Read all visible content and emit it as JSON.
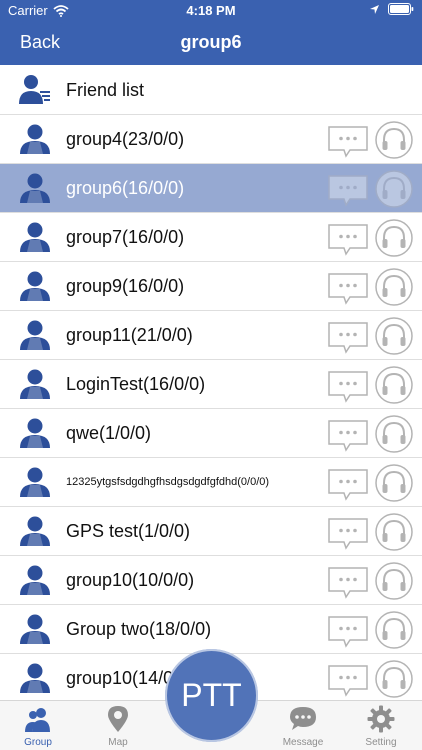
{
  "status": {
    "carrier": "Carrier",
    "time": "4:18 PM"
  },
  "nav": {
    "back_label": "Back",
    "title": "group6"
  },
  "friend_list": {
    "label": "Friend list"
  },
  "groups": [
    {
      "label": "group4(23/0/0)",
      "selected": false
    },
    {
      "label": "group6(16/0/0)",
      "selected": true
    },
    {
      "label": "group7(16/0/0)",
      "selected": false
    },
    {
      "label": "group9(16/0/0)",
      "selected": false
    },
    {
      "label": "group11(21/0/0)",
      "selected": false
    },
    {
      "label": "LoginTest(16/0/0)",
      "selected": false
    },
    {
      "label": "qwe(1/0/0)",
      "selected": false
    },
    {
      "label": "12325ytgsfsdgdhgfhsdgsdgdfgfdhd(0/0/0)",
      "selected": false,
      "small": true
    },
    {
      "label": "GPS test(1/0/0)",
      "selected": false
    },
    {
      "label": "group10(10/0/0)",
      "selected": false
    },
    {
      "label": "Group two(18/0/0)",
      "selected": false
    },
    {
      "label": "group10(14/0/0)",
      "selected": false
    }
  ],
  "ptt": {
    "label": "PTT"
  },
  "tabs": [
    {
      "label": "Group",
      "icon": "group-icon",
      "active": true
    },
    {
      "label": "Map",
      "icon": "map-pin-icon",
      "active": false
    },
    {
      "label": "Message",
      "icon": "chat-bubble-icon",
      "active": false
    },
    {
      "label": "Setting",
      "icon": "gear-icon",
      "active": false
    }
  ],
  "colors": {
    "primary": "#3a61b0",
    "selected_row": "#96a9d2",
    "button_outline": "#b4b4b4"
  }
}
